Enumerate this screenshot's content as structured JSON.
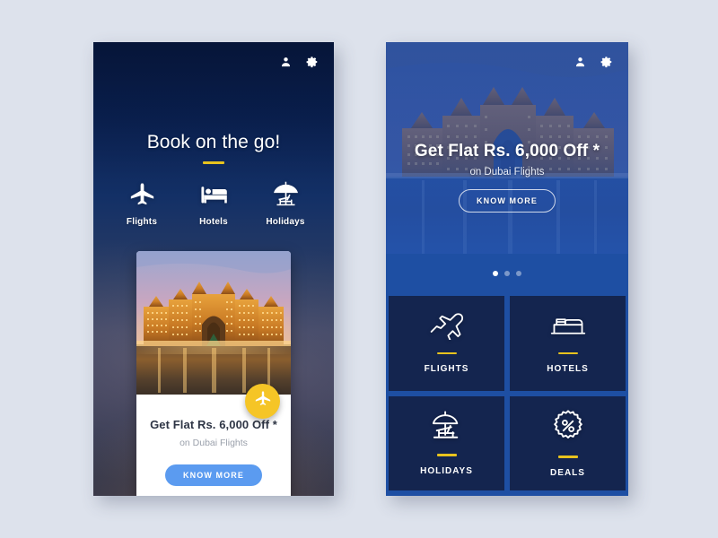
{
  "colors": {
    "page_bg": "#dde2ec",
    "accent_yellow": "#e8c31e",
    "deep_navy": "#07183f",
    "tile_navy": "#14254f",
    "brand_blue": "#1e4fa3",
    "button_blue": "#5b9bf0",
    "fab_yellow": "#f5c526",
    "card_white": "#ffffff"
  },
  "screens": [
    {
      "id": "home-book-on-the-go",
      "topbar": {
        "profile_icon": "person-icon",
        "settings_icon": "gear-icon"
      },
      "title": "Book on the go!",
      "quick_nav": [
        {
          "label": "Flights",
          "icon": "airplane-icon"
        },
        {
          "label": "Hotels",
          "icon": "bed-icon"
        },
        {
          "label": "Holidays",
          "icon": "beach-umbrella-icon"
        }
      ],
      "offer_card": {
        "image_alt": "atlantis-the-palm-dubai-night",
        "fab_icon": "airplane-icon",
        "title": "Get Flat Rs. 6,000 Off *",
        "subtitle": "on Dubai Flights",
        "button_label": "KNOW MORE"
      }
    },
    {
      "id": "home-dashboard",
      "topbar": {
        "profile_icon": "person-icon",
        "settings_icon": "gear-icon"
      },
      "hero": {
        "image_alt": "atlantis-the-palm-dubai-night",
        "headline": "Get Flat Rs. 6,000 Off *",
        "subhead": "on Dubai Flights",
        "button_label": "KNOW MORE",
        "carousel": {
          "total": 3,
          "active_index": 0
        }
      },
      "tiles": [
        {
          "label": "FLIGHTS",
          "icon": "airplane-takeoff-icon"
        },
        {
          "label": "HOTELS",
          "icon": "bed-icon"
        },
        {
          "label": "HOLIDAYS",
          "icon": "beach-umbrella-icon"
        },
        {
          "label": "DEALS",
          "icon": "percent-badge-icon"
        }
      ]
    }
  ]
}
